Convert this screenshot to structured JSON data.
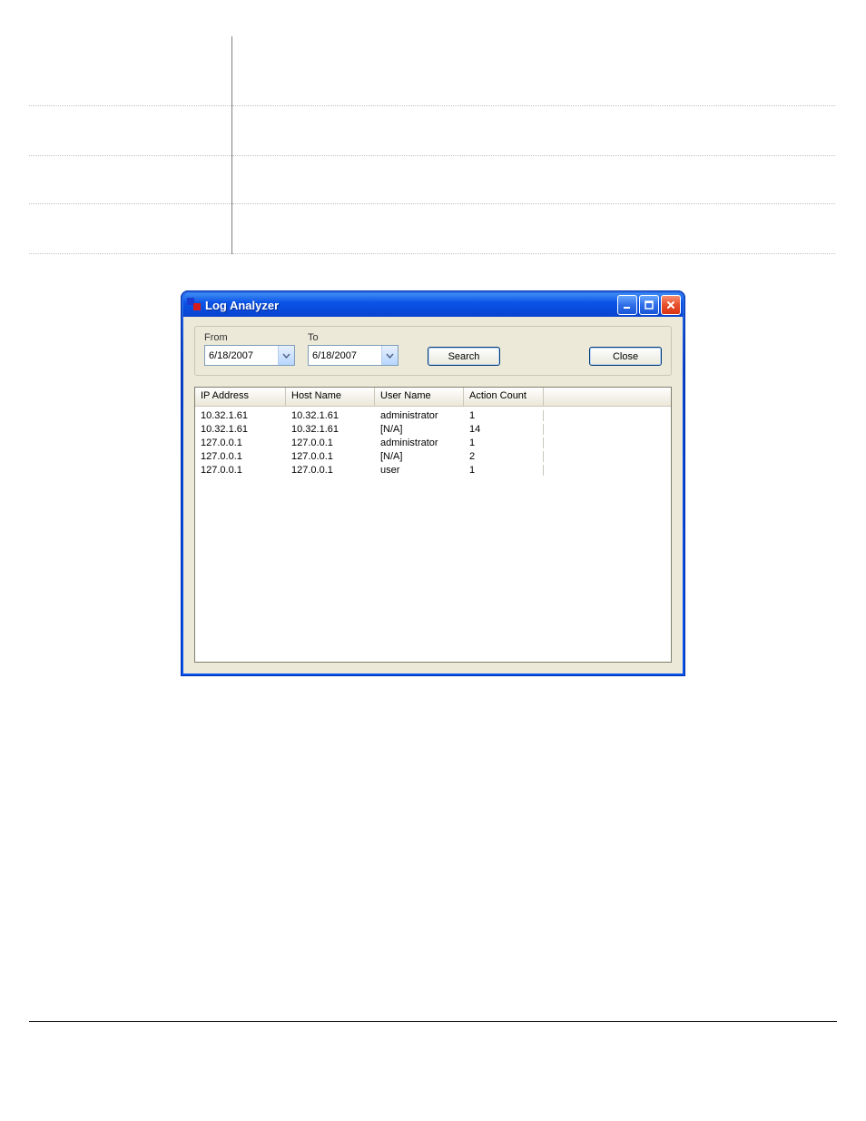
{
  "window": {
    "title": "Log Analyzer"
  },
  "toolbar": {
    "from_label": "From",
    "to_label": "To",
    "from_value": "6/18/2007",
    "to_value": "6/18/2007",
    "search_label": "Search",
    "close_label": "Close"
  },
  "columns": {
    "ip": "IP Address",
    "host": "Host Name",
    "user": "User Name",
    "count": "Action Count"
  },
  "rows": [
    {
      "ip": "10.32.1.61",
      "host": "10.32.1.61",
      "user": "administrator",
      "count": "1"
    },
    {
      "ip": "10.32.1.61",
      "host": "10.32.1.61",
      "user": "[N/A]",
      "count": "14"
    },
    {
      "ip": "127.0.0.1",
      "host": "127.0.0.1",
      "user": "administrator",
      "count": "1"
    },
    {
      "ip": "127.0.0.1",
      "host": "127.0.0.1",
      "user": "[N/A]",
      "count": "2"
    },
    {
      "ip": "127.0.0.1",
      "host": "127.0.0.1",
      "user": "user",
      "count": "1"
    }
  ]
}
